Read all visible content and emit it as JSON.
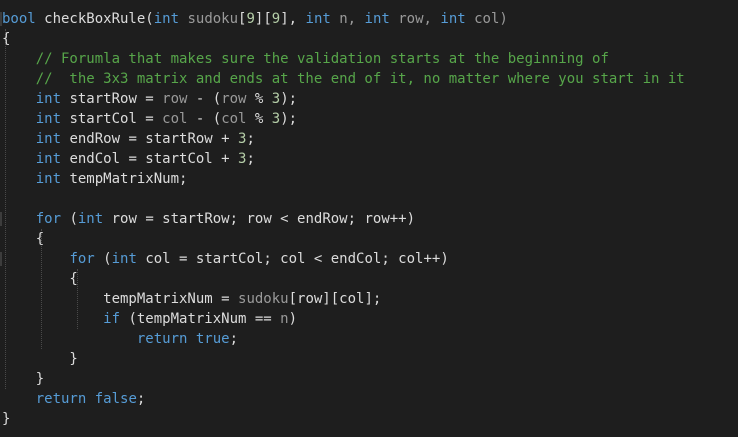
{
  "editor": {
    "lines": [
      [
        {
          "t": "bool",
          "k": "kw"
        },
        {
          "t": " checkBoxRule(",
          "k": "plain"
        },
        {
          "t": "int",
          "k": "kw"
        },
        {
          "t": " sudoku",
          "k": "param"
        },
        {
          "t": "[",
          "k": "plain"
        },
        {
          "t": "9",
          "k": "num"
        },
        {
          "t": "][",
          "k": "plain"
        },
        {
          "t": "9",
          "k": "num"
        },
        {
          "t": "], ",
          "k": "plain"
        },
        {
          "t": "int",
          "k": "kw"
        },
        {
          "t": " n, ",
          "k": "param"
        },
        {
          "t": "int",
          "k": "kw"
        },
        {
          "t": " row, ",
          "k": "param"
        },
        {
          "t": "int",
          "k": "kw"
        },
        {
          "t": " col)",
          "k": "param"
        }
      ],
      [
        {
          "t": "{",
          "k": "plain"
        }
      ],
      [
        {
          "t": "    // Forumla that makes sure the validation starts at the beginning of",
          "k": "comment"
        }
      ],
      [
        {
          "t": "    //  the 3x3 matrix and ends at the end of it, no matter where you start in it",
          "k": "comment"
        }
      ],
      [
        {
          "t": "    ",
          "k": "plain"
        },
        {
          "t": "int",
          "k": "kw"
        },
        {
          "t": " startRow = ",
          "k": "plain"
        },
        {
          "t": "row",
          "k": "param"
        },
        {
          "t": " - (",
          "k": "plain"
        },
        {
          "t": "row",
          "k": "param"
        },
        {
          "t": " % ",
          "k": "plain"
        },
        {
          "t": "3",
          "k": "num"
        },
        {
          "t": ");",
          "k": "plain"
        }
      ],
      [
        {
          "t": "    ",
          "k": "plain"
        },
        {
          "t": "int",
          "k": "kw"
        },
        {
          "t": " startCol = ",
          "k": "plain"
        },
        {
          "t": "col",
          "k": "param"
        },
        {
          "t": " - (",
          "k": "plain"
        },
        {
          "t": "col",
          "k": "param"
        },
        {
          "t": " % ",
          "k": "plain"
        },
        {
          "t": "3",
          "k": "num"
        },
        {
          "t": ");",
          "k": "plain"
        }
      ],
      [
        {
          "t": "    ",
          "k": "plain"
        },
        {
          "t": "int",
          "k": "kw"
        },
        {
          "t": " endRow = startRow + ",
          "k": "plain"
        },
        {
          "t": "3",
          "k": "num"
        },
        {
          "t": ";",
          "k": "plain"
        }
      ],
      [
        {
          "t": "    ",
          "k": "plain"
        },
        {
          "t": "int",
          "k": "kw"
        },
        {
          "t": " endCol = startCol + ",
          "k": "plain"
        },
        {
          "t": "3",
          "k": "num"
        },
        {
          "t": ";",
          "k": "plain"
        }
      ],
      [
        {
          "t": "    ",
          "k": "plain"
        },
        {
          "t": "int",
          "k": "kw"
        },
        {
          "t": " tempMatrixNum;",
          "k": "plain"
        }
      ],
      [],
      [
        {
          "t": "    ",
          "k": "plain"
        },
        {
          "t": "for",
          "k": "kw"
        },
        {
          "t": " (",
          "k": "plain"
        },
        {
          "t": "int",
          "k": "kw"
        },
        {
          "t": " row = startRow; row < endRow; row++)",
          "k": "plain"
        }
      ],
      [
        {
          "t": "    {",
          "k": "plain"
        }
      ],
      [
        {
          "t": "        ",
          "k": "plain"
        },
        {
          "t": "for",
          "k": "kw"
        },
        {
          "t": " (",
          "k": "plain"
        },
        {
          "t": "int",
          "k": "kw"
        },
        {
          "t": " col = startCol; col < endCol; col++)",
          "k": "plain"
        }
      ],
      [
        {
          "t": "        {",
          "k": "plain"
        }
      ],
      [
        {
          "t": "            tempMatrixNum = ",
          "k": "plain"
        },
        {
          "t": "sudoku",
          "k": "param"
        },
        {
          "t": "[row][col];",
          "k": "plain"
        }
      ],
      [
        {
          "t": "            ",
          "k": "plain"
        },
        {
          "t": "if",
          "k": "kw"
        },
        {
          "t": " (tempMatrixNum == ",
          "k": "plain"
        },
        {
          "t": "n",
          "k": "param"
        },
        {
          "t": ")",
          "k": "plain"
        }
      ],
      [
        {
          "t": "                ",
          "k": "plain"
        },
        {
          "t": "return",
          "k": "kw"
        },
        {
          "t": " ",
          "k": "plain"
        },
        {
          "t": "true",
          "k": "kw"
        },
        {
          "t": ";",
          "k": "plain"
        }
      ],
      [
        {
          "t": "        }",
          "k": "plain"
        }
      ],
      [
        {
          "t": "    }",
          "k": "plain"
        }
      ],
      [
        {
          "t": "    ",
          "k": "plain"
        },
        {
          "t": "return",
          "k": "kw"
        },
        {
          "t": " ",
          "k": "plain"
        },
        {
          "t": "false",
          "k": "kw"
        },
        {
          "t": ";",
          "k": "plain"
        }
      ],
      [
        {
          "t": "}",
          "k": "plain"
        }
      ]
    ]
  },
  "colors": {
    "background": "#1e1e1e",
    "keyword": "#569cd6",
    "comment": "#57a64a",
    "parameter": "#9a9a9a",
    "number": "#b5cea8",
    "text": "#dcdcdc"
  }
}
